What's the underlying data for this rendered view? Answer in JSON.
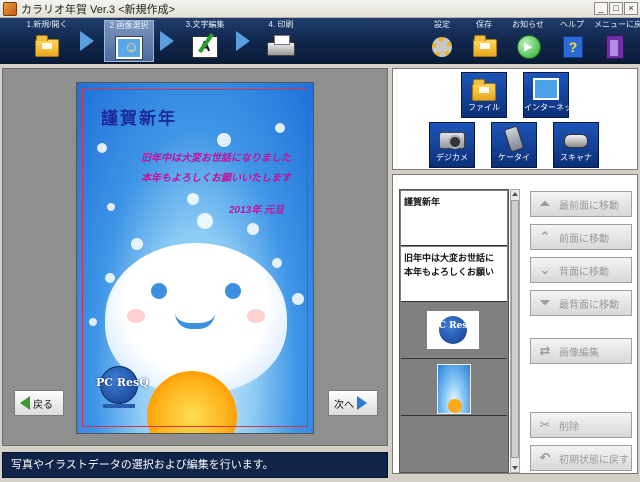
{
  "window": {
    "title": "カラリオ年賀 Ver.3 <新規作成>",
    "buttons": [
      "_",
      "□",
      "×"
    ]
  },
  "toolbar": {
    "steps": [
      {
        "label": "1.新規/開く",
        "icon": "folder-icon"
      },
      {
        "label": "2.画像選択",
        "icon": "image-select-icon"
      },
      {
        "label": "3.文字編集",
        "icon": "text-edit-icon"
      },
      {
        "label": "4. 印刷",
        "icon": "printer-icon"
      }
    ],
    "actions": [
      {
        "label": "設定",
        "icon": "settings-icon"
      },
      {
        "label": "保存",
        "icon": "save-icon"
      },
      {
        "label": "お知らせ",
        "icon": "info-icon"
      },
      {
        "label": "ヘルプ",
        "icon": "help-icon"
      },
      {
        "label": "メニューに戻る",
        "icon": "exit-icon"
      }
    ]
  },
  "card": {
    "title": "謹賀新年",
    "line1": "旧年中は大変お世話になりました",
    "line2": "本年もよろしくお願いいたします",
    "date": "2013年 元旦",
    "logo_text": "PC ResQ"
  },
  "navigation": {
    "back_label": "戻る",
    "next_label": "次へ"
  },
  "status": {
    "message": "写真やイラストデータの選択および編集を行います。"
  },
  "sources": {
    "file": "ファイル",
    "internet": "インターネット",
    "camera": "デジカメ",
    "phone": "ケータイ",
    "scanner": "スキャナ"
  },
  "layers": {
    "items": [
      {
        "type": "text",
        "lines": [
          "謹賀新年"
        ]
      },
      {
        "type": "text",
        "lines": [
          "旧年中は大変お世話に",
          "本年もよろしくお願い"
        ]
      },
      {
        "type": "image",
        "text": "PC ResQ"
      },
      {
        "type": "image",
        "text": ""
      }
    ]
  },
  "actions": {
    "bring_front": "最前面に移動",
    "forward": "前面に移動",
    "backward": "背面に移動",
    "send_back": "最背面に移動",
    "edit_image": "画像編集",
    "delete": "削除",
    "reset": "初期状態に戻す"
  },
  "colors": {
    "toolbar_bg": "#0f2448",
    "card_title": "#1a2a9c",
    "card_text": "#c0129a",
    "accent_blue": "#2a7ad6"
  }
}
